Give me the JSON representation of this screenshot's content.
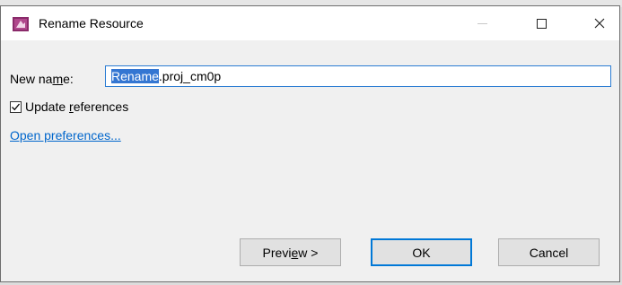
{
  "window": {
    "title": "Rename Resource",
    "icon": "eclipse-rename-icon"
  },
  "form": {
    "name_label_pre": "New na",
    "name_label_mnemonic": "m",
    "name_label_post": "e:",
    "name_value_selected": "Rename",
    "name_value_rest": ".proj_cm0p",
    "update_refs_checked": true,
    "update_refs_pre": "Update ",
    "update_refs_mnemonic": "r",
    "update_refs_post": "eferences",
    "open_prefs_link": "Open preferences..."
  },
  "buttons": {
    "preview_pre": "Previ",
    "preview_mnemonic": "e",
    "preview_post": "w >",
    "ok": "OK",
    "cancel": "Cancel"
  },
  "colors": {
    "accent": "#0078d7",
    "selection": "#3476d2",
    "link": "#0066cc"
  }
}
